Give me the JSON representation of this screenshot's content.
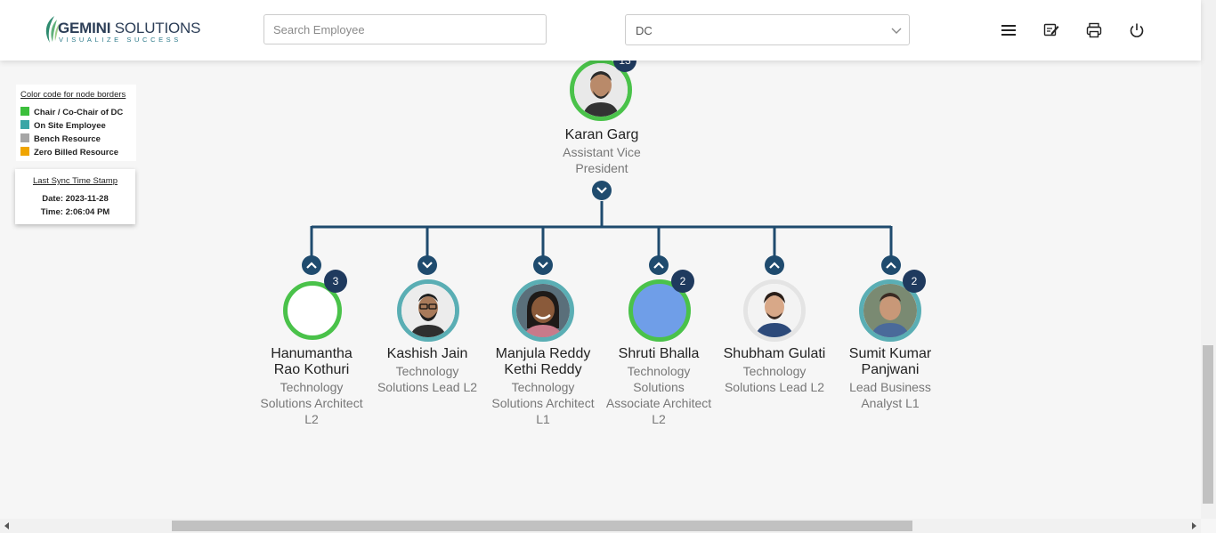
{
  "brand": {
    "name_bold": "GEMINI",
    "name_rest": " SOLUTIONS",
    "tagline": "VISUALIZE SUCCESS",
    "accent": "#1f3a5e"
  },
  "search": {
    "placeholder": "Search Employee",
    "value": ""
  },
  "dc_select": {
    "selected": "DC"
  },
  "header_icons": [
    "menu-icon",
    "edit-note-icon",
    "printer-icon",
    "power-icon"
  ],
  "legend": {
    "title": "Color code for node borders",
    "items": [
      {
        "label": "Chair / Co-Chair of DC",
        "color": "#3cbf3c"
      },
      {
        "label": "On Site Employee",
        "color": "#3aa6a6"
      },
      {
        "label": "Bench Resource",
        "color": "#a6a6a6"
      },
      {
        "label": "Zero Billed Resource",
        "color": "#f0a500"
      }
    ]
  },
  "sync": {
    "title": "Last Sync Time Stamp",
    "date": "Date: 2023-11-28",
    "time": "Time: 2:06:04 PM"
  },
  "root": {
    "name": "Karan Garg",
    "title_l1": "Assistant Vice",
    "title_l2": "President",
    "count": "13",
    "border": "#4ac24a"
  },
  "children": [
    {
      "name_l1": "Hanumantha",
      "name_l2": "Rao Kothuri",
      "title_lines": [
        "Technology",
        "Solutions Architect",
        "L2"
      ],
      "count": "3",
      "border": "#4ac24a",
      "photo": "blank",
      "toggle": "collapse"
    },
    {
      "name_l1": "Kashish Jain",
      "name_l2": "",
      "title_lines": [
        "Technology",
        "Solutions Lead L2"
      ],
      "count": "",
      "border": "#5aaeb4",
      "photo": "person",
      "toggle": "expand"
    },
    {
      "name_l1": "Manjula Reddy",
      "name_l2": "Kethi Reddy",
      "title_lines": [
        "Technology",
        "Solutions Architect",
        "L1"
      ],
      "count": "",
      "border": "#5aaeb4",
      "photo": "person",
      "toggle": "expand"
    },
    {
      "name_l1": "Shruti Bhalla",
      "name_l2": "",
      "title_lines": [
        "Technology",
        "Solutions",
        "Associate Architect",
        "L2"
      ],
      "count": "2",
      "border": "#4ac24a",
      "photo": "placeholder",
      "toggle": "collapse"
    },
    {
      "name_l1": "Shubham Gulati",
      "name_l2": "",
      "title_lines": [
        "Technology",
        "Solutions Lead L2"
      ],
      "count": "",
      "border": "#e8e8e8",
      "photo": "person",
      "toggle": "collapse"
    },
    {
      "name_l1": "Sumit Kumar",
      "name_l2": "Panjwani",
      "title_lines": [
        "Lead Business",
        "Analyst L1"
      ],
      "count": "2",
      "border": "#5aaeb4",
      "photo": "person",
      "toggle": "collapse"
    }
  ]
}
